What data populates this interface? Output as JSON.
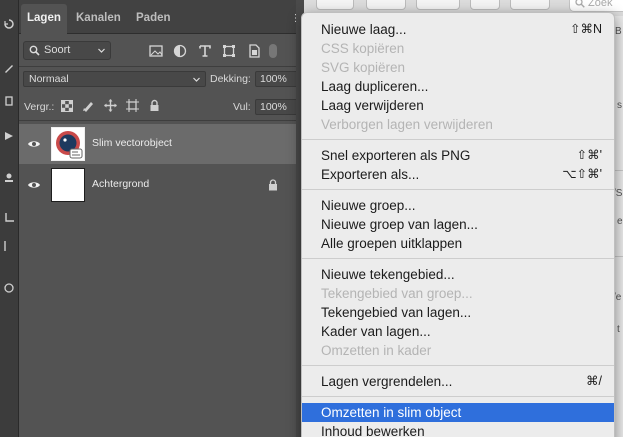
{
  "layers_panel": {
    "tabs": [
      "Lagen",
      "Kanalen",
      "Paden"
    ],
    "filter": {
      "label": "Soort"
    },
    "blend_mode": "Normaal",
    "opacity": {
      "label": "Dekking:",
      "value": "100%"
    },
    "lock": {
      "label": "Vergr.:"
    },
    "fill": {
      "label": "Vul:",
      "value": "100%"
    },
    "layers": [
      {
        "name": "Slim vectorobject",
        "selected": true
      },
      {
        "name": "Achtergrond",
        "locked": true
      }
    ]
  },
  "background_app": {
    "search_placeholder": "Zoek",
    "side_letters": [
      "B",
      "s",
      "/S",
      "e",
      "/e",
      "t"
    ]
  },
  "context_menu": {
    "items": [
      {
        "label": "Nieuwe laag...",
        "shortcut": "⇧⌘N",
        "enabled": true
      },
      {
        "label": "CSS kopiëren",
        "enabled": false
      },
      {
        "label": "SVG kopiëren",
        "enabled": false
      },
      {
        "label": "Laag dupliceren...",
        "enabled": true
      },
      {
        "label": "Laag verwijderen",
        "enabled": true
      },
      {
        "label": "Verborgen lagen verwijderen",
        "enabled": false
      },
      {
        "label": "Snel exporteren als PNG",
        "shortcut": "⇧⌘'",
        "enabled": true
      },
      {
        "label": "Exporteren als...",
        "shortcut": "⌥⇧⌘'",
        "enabled": true
      },
      {
        "label": "Nieuwe groep...",
        "enabled": true
      },
      {
        "label": "Nieuwe groep van lagen...",
        "enabled": true
      },
      {
        "label": "Alle groepen uitklappen",
        "enabled": true
      },
      {
        "label": "Nieuwe tekengebied...",
        "enabled": true
      },
      {
        "label": "Tekengebied van groep...",
        "enabled": false
      },
      {
        "label": "Tekengebied van lagen...",
        "enabled": true
      },
      {
        "label": "Kader van lagen...",
        "enabled": true
      },
      {
        "label": "Omzetten in kader",
        "enabled": false
      },
      {
        "label": "Lagen vergrendelen...",
        "shortcut": "⌘/",
        "enabled": true
      },
      {
        "label": "Omzetten in slim object",
        "enabled": true,
        "highlighted": true
      },
      {
        "label": "Inhoud bewerken",
        "enabled": true
      }
    ]
  },
  "colors": {
    "menu_highlight": "#2f6fdc",
    "panel_bg": "#535353",
    "selected_layer": "#6b6b6b"
  }
}
